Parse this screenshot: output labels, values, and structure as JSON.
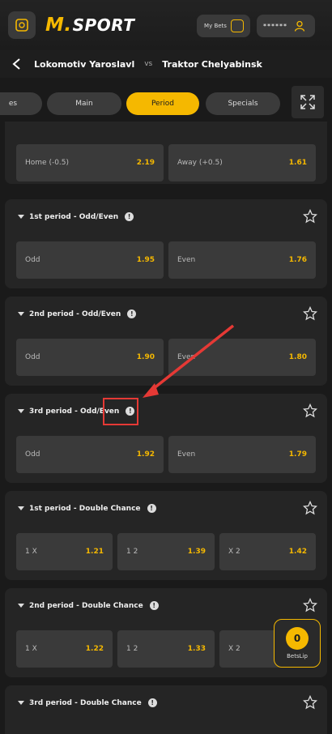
{
  "header": {
    "brand_prefix": "M.",
    "brand_name": "SPORT",
    "mybets_label": "My Bets",
    "account_masked": "******"
  },
  "match": {
    "home": "Lokomotiv Yaroslavl",
    "vs": "vs",
    "away": "Traktor Chelyabinsk"
  },
  "tabs": [
    {
      "label": "es"
    },
    {
      "label": "Main"
    },
    {
      "label": "Period",
      "active": true
    },
    {
      "label": "Specials"
    }
  ],
  "cards": [
    {
      "title": "",
      "odds": [
        {
          "label": "Home (-0.5)",
          "value": "2.19"
        },
        {
          "label": "Away (+0.5)",
          "value": "1.61"
        }
      ]
    },
    {
      "title": "1st period - Odd/Even",
      "odds": [
        {
          "label": "Odd",
          "value": "1.95"
        },
        {
          "label": "Even",
          "value": "1.76"
        }
      ]
    },
    {
      "title": "2nd period - Odd/Even",
      "odds": [
        {
          "label": "Odd",
          "value": "1.90"
        },
        {
          "label": "Even",
          "value": "1.80"
        }
      ]
    },
    {
      "title": "3rd period - Odd/Even",
      "odds": [
        {
          "label": "Odd",
          "value": "1.92"
        },
        {
          "label": "Even",
          "value": "1.79"
        }
      ]
    },
    {
      "title": "1st period - Double Chance",
      "odds": [
        {
          "label": "1 X",
          "value": "1.21"
        },
        {
          "label": "1 2",
          "value": "1.39"
        },
        {
          "label": "X 2",
          "value": "1.42"
        }
      ]
    },
    {
      "title": "2nd period - Double Chance",
      "odds": [
        {
          "label": "1 X",
          "value": "1.22"
        },
        {
          "label": "1 2",
          "value": "1.33"
        },
        {
          "label": "X 2",
          "value": ""
        }
      ]
    },
    {
      "title": "3rd period - Double Chance",
      "odds": []
    }
  ],
  "betslip": {
    "count": "0",
    "label": "BetsLip"
  },
  "colors": {
    "accent": "#f5b800",
    "card": "#252525",
    "odd_bg": "#3a3a3a",
    "annotation": "#e53935"
  }
}
